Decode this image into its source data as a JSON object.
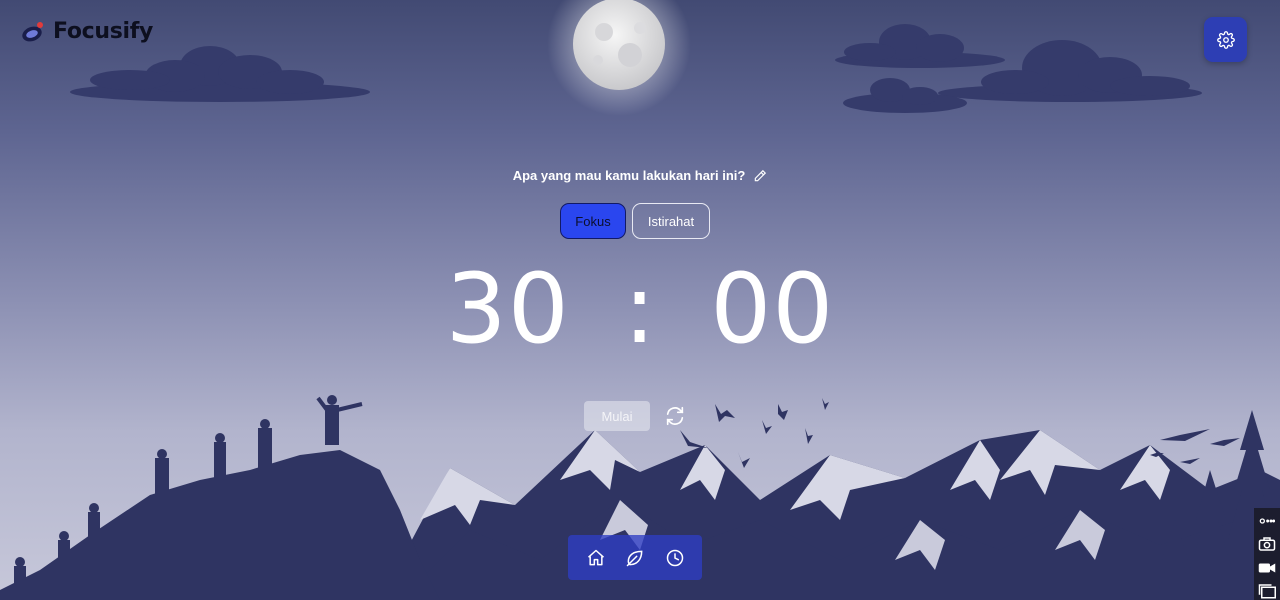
{
  "app": {
    "name": "Focusify"
  },
  "header": {
    "settings_icon": "gear-icon"
  },
  "task": {
    "prompt": "Apa yang mau kamu lakukan hari ini?",
    "edit_icon": "pencil-icon"
  },
  "modes": {
    "focus_label": "Fokus",
    "break_label": "Istirahat",
    "active": "Fokus"
  },
  "timer": {
    "minutes": "30",
    "separator": ":",
    "seconds": "00"
  },
  "controls": {
    "start_label": "Mulai",
    "reset_icon": "refresh-icon"
  },
  "bottom_nav": {
    "items": [
      "home-icon",
      "leaf-icon",
      "clock-icon"
    ]
  },
  "side_tools": {
    "items": [
      "link-icon",
      "camera-icon",
      "video-icon",
      "window-icon"
    ]
  },
  "colors": {
    "accent": "#2a46ef",
    "settings_button": "#2d3eb4",
    "silhouette": "#2f3462",
    "sky_top": "#424a73",
    "sky_bottom": "#c7c8da"
  }
}
